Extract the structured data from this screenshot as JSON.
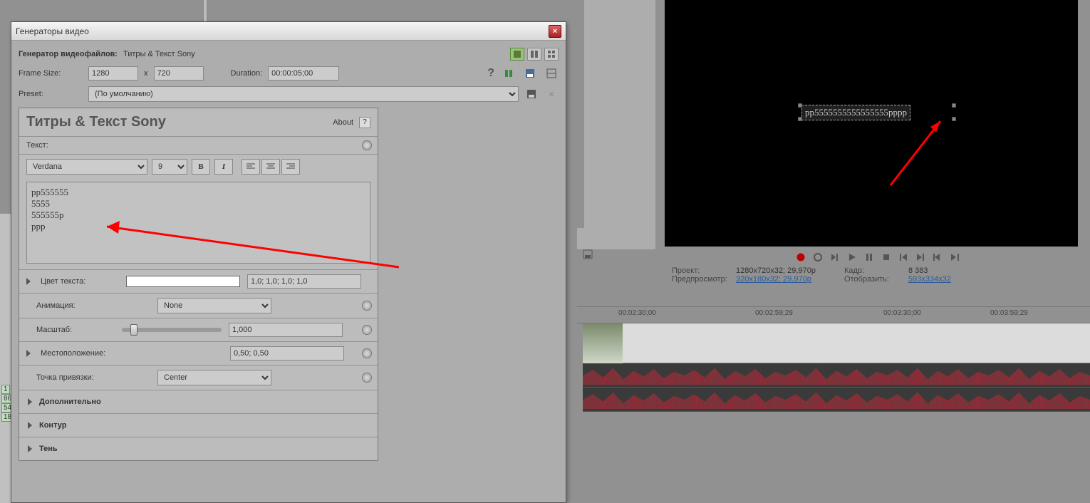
{
  "dialog": {
    "title": "Генераторы видео",
    "generator_label": "Генератор видеофайлов:",
    "generator_value": "Титры & Текст Sony",
    "frame_size_label": "Frame Size:",
    "width": "1280",
    "x_sep": "x",
    "height": "720",
    "duration_label": "Duration:",
    "duration_value": "00:00:05;00",
    "preset_label": "Preset:",
    "preset_value": "(По умолчанию)"
  },
  "panel": {
    "title": "Титры & Текст Sony",
    "about": "About",
    "q": "?",
    "text_label": "Текст:",
    "font": "Verdana",
    "size": "9",
    "text_content": "pp555555\n5555\n555555p\nppp",
    "color_label": "Цвет текста:",
    "color_rgba": "1,0; 1,0; 1,0; 1,0",
    "anim_label": "Анимация:",
    "anim_value": "None",
    "scale_label": "Масштаб:",
    "scale_value": "1,000",
    "pos_label": "Местоположение:",
    "pos_value": "0,50; 0,50",
    "anchor_label": "Точка привязки:",
    "anchor_value": "Center",
    "adv": "Дополнительно",
    "outline": "Контур",
    "shadow": "Тень"
  },
  "preview": {
    "overlay_text": "pp5555555555555555pppp"
  },
  "transport": {
    "project_lbl": "Проект:",
    "project_val": "1280x720x32; 29,970p",
    "frame_lbl": "Кадр:",
    "frame_val": "8 383",
    "preview_lbl": "Предпросмотр:",
    "preview_val": "320x180x32; 29,970p",
    "display_lbl": "Отобразить:",
    "display_val": "593x334x32"
  },
  "ruler": {
    "t1": "00:02:30;00",
    "t2": "00:02:59;29",
    "t3": "00:03:30;00",
    "t4": "00:03:59;29"
  },
  "leftstrip": {
    "a": "1",
    "b": "86",
    "c": "54",
    "d": "18"
  }
}
